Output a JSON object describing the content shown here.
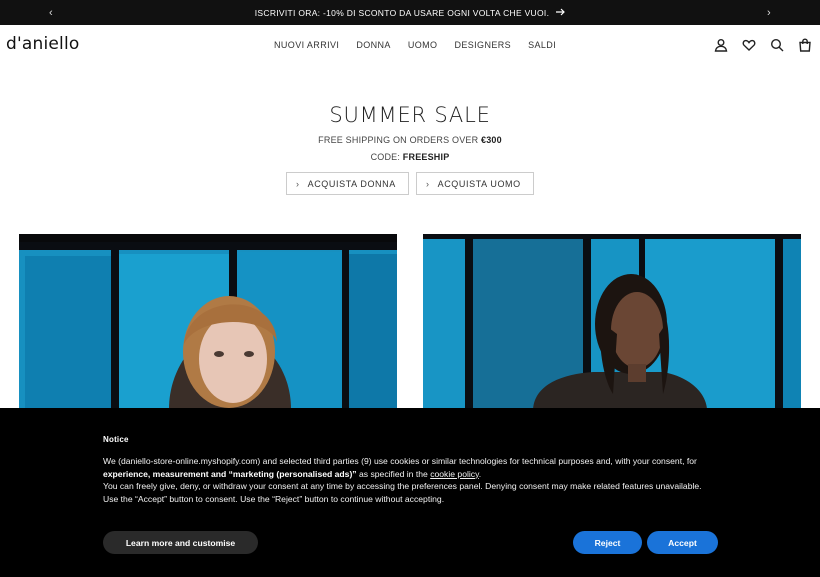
{
  "announcement": {
    "prev_icon": "chevron-left-icon",
    "next_icon": "chevron-right-icon",
    "text": "ISCRIVITI ORA: -10% DI SCONTO DA USARE OGNI VOLTA CHE VUOI.",
    "arrow_icon": "arrow-right-icon"
  },
  "header": {
    "logo": "d'aniello",
    "nav": [
      {
        "label": "NUOVI ARRIVI"
      },
      {
        "label": "DONNA"
      },
      {
        "label": "UOMO"
      },
      {
        "label": "DESIGNERS"
      },
      {
        "label": "SALDI"
      }
    ],
    "icons": [
      "account-icon",
      "heart-icon",
      "search-icon",
      "bag-icon"
    ]
  },
  "hero": {
    "title": "SUMMER SALE",
    "line1_prefix": "FREE SHIPPING ON ORDERS OVER ",
    "line1_bold": "€300",
    "line2_prefix": "CODE: ",
    "line2_bold": "FREESHIP",
    "cta_donna": "ACQUISTA DONNA",
    "cta_uomo": "ACQUISTA UOMO"
  },
  "cookie": {
    "title": "Notice",
    "p1_a": "We (daniello-store-online.myshopify.com) and selected third parties (9) use cookies or similar technologies for technical purposes and, with your consent, for ",
    "p1_b": "experience, measurement and “marketing (personalised ads)”",
    "p1_c": " as specified in the ",
    "p1_link": "cookie policy",
    "p1_d": ".",
    "p2": "You can freely give, deny, or withdraw your consent at any time by accessing the preferences panel. Denying consent may make related features unavailable.",
    "p3": "Use the “Accept” button to consent. Use the “Reject” button to continue without accepting.",
    "learn_label": "Learn more and customise",
    "reject_label": "Reject",
    "accept_label": "Accept",
    "accent_color": "#1a73d9"
  }
}
